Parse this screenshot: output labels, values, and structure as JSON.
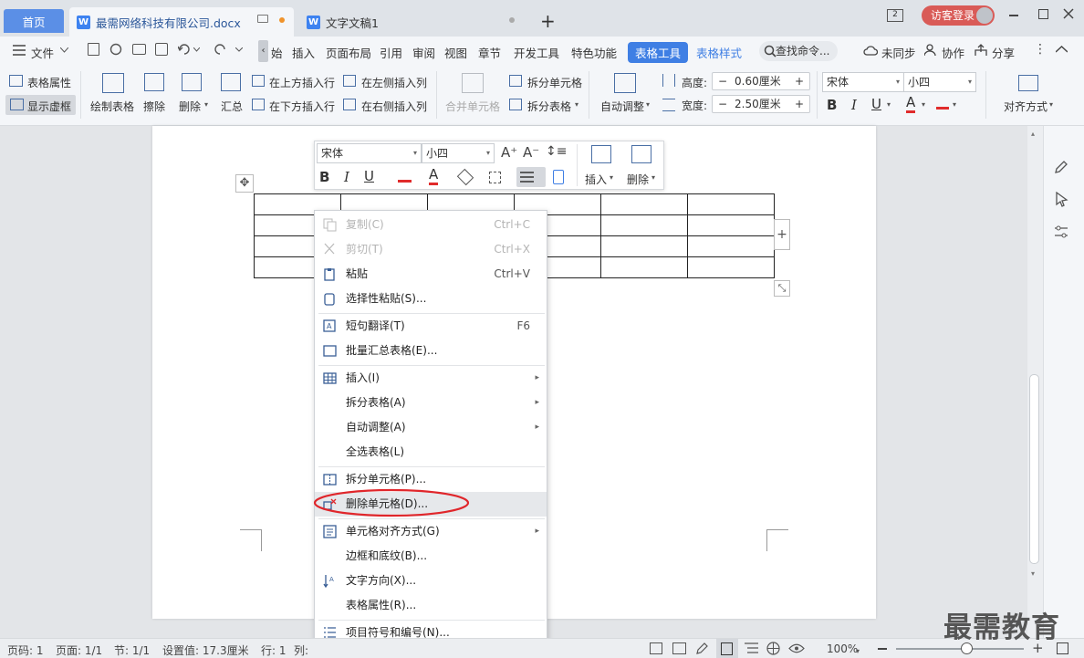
{
  "tabs": {
    "home": "首页",
    "doc1": "最需网络科技有限公司.docx",
    "doc2": "文字文稿1",
    "add": "+"
  },
  "titlebar": {
    "badge": "2",
    "login": "访客登录"
  },
  "menu": {
    "file": "文件",
    "items": [
      "始",
      "插入",
      "页面布局",
      "引用",
      "审阅",
      "视图",
      "章节",
      "开发工具",
      "特色功能"
    ],
    "table_tools": "表格工具",
    "table_style": "表格样式",
    "search": "查找命令...",
    "unsynced": "未同步",
    "collab": "协作",
    "share": "分享"
  },
  "ribbon": {
    "table_props": "表格属性",
    "show_gridlines": "显示虚框",
    "draw_table": "绘制表格",
    "eraser": "擦除",
    "delete": "删除",
    "sum": "汇总",
    "insert_above": "在上方插入行",
    "insert_below": "在下方插入行",
    "insert_left": "在左侧插入列",
    "insert_right": "在右侧插入列",
    "merge_cells": "合并单元格",
    "split_cells": "拆分单元格",
    "split_table": "拆分表格",
    "auto_fit": "自动调整",
    "height_label": "高度:",
    "height_value": "0.60厘米",
    "width_label": "宽度:",
    "width_value": "2.50厘米",
    "font": "宋体",
    "size": "小四",
    "align": "对齐方式"
  },
  "floatbar": {
    "font": "宋体",
    "size": "小四",
    "insert": "插入",
    "delete": "删除"
  },
  "context_menu": [
    {
      "label": "复制(C)",
      "shortcut": "Ctrl+C",
      "disabled": true
    },
    {
      "label": "剪切(T)",
      "shortcut": "Ctrl+X",
      "disabled": true
    },
    {
      "label": "粘贴",
      "shortcut": "Ctrl+V"
    },
    {
      "label": "选择性粘贴(S)..."
    },
    {
      "label": "短句翻译(T)",
      "shortcut": "F6"
    },
    {
      "label": "批量汇总表格(E)..."
    },
    {
      "label": "插入(I)"
    },
    {
      "label": "拆分表格(A)"
    },
    {
      "label": "自动调整(A)"
    },
    {
      "label": "全选表格(L)"
    },
    {
      "label": "拆分单元格(P)..."
    },
    {
      "label": "删除单元格(D)..."
    },
    {
      "label": "单元格对齐方式(G)"
    },
    {
      "label": "边框和底纹(B)..."
    },
    {
      "label": "文字方向(X)..."
    },
    {
      "label": "表格属性(R)..."
    },
    {
      "label": "项目符号和编号(N)..."
    }
  ],
  "status": {
    "page": "页码: 1",
    "pages": "页面: 1/1",
    "section": "节: 1/1",
    "setting": "设置值: 17.3厘米",
    "row": "行: 1",
    "col": "列:",
    "zoom": "100%",
    "zoom_fraction": 0.55
  },
  "watermark": "最需教育",
  "colors": {
    "accent": "#3f7fe4",
    "login": "#d95b57",
    "highlight_ring": "#e0262b"
  }
}
